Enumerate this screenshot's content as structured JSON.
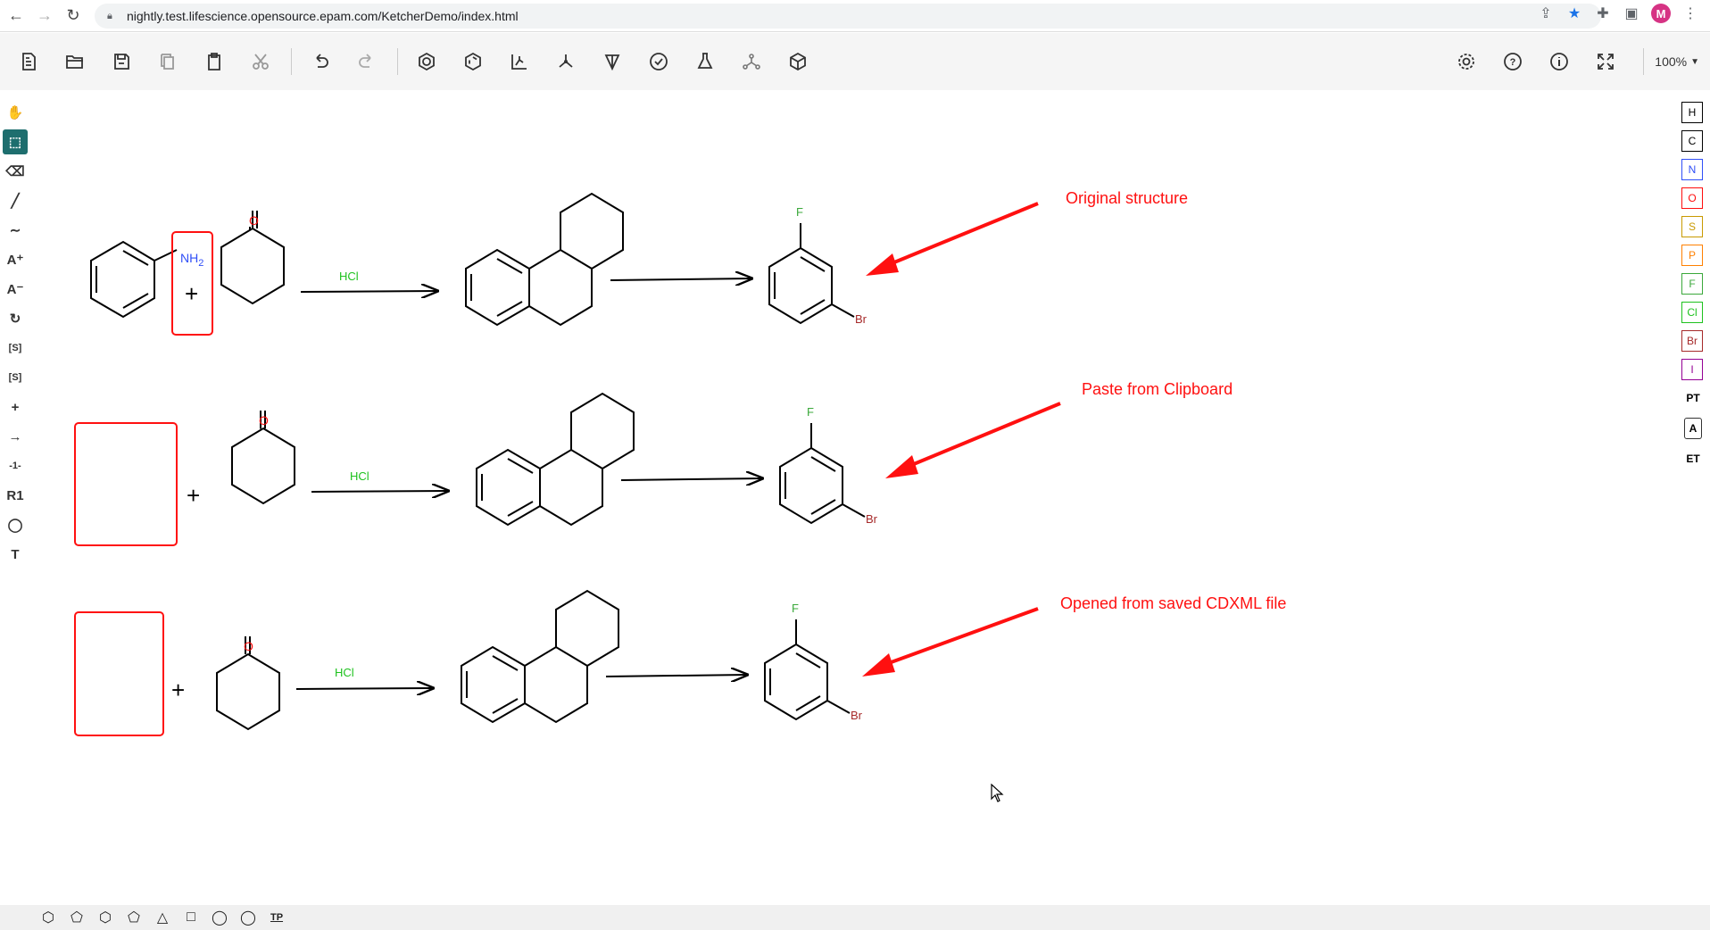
{
  "browser": {
    "url": "nightly.test.lifescience.opensource.epam.com/KetcherDemo/index.html",
    "profile_initial": "M"
  },
  "toolbar": {
    "zoom": "100%"
  },
  "left_tools": [
    {
      "name": "hand-tool",
      "glyph": "✋"
    },
    {
      "name": "select-tool",
      "glyph": "⬚"
    },
    {
      "name": "erase-tool",
      "glyph": "⌫"
    },
    {
      "name": "bond-tool",
      "glyph": "╱"
    },
    {
      "name": "chain-tool",
      "glyph": "∼"
    },
    {
      "name": "charge-plus-tool",
      "glyph": "A⁺"
    },
    {
      "name": "charge-minus-tool",
      "glyph": "A⁻"
    },
    {
      "name": "rotate-tool",
      "glyph": "↻"
    },
    {
      "name": "sgroup-tool",
      "glyph": "[S]"
    },
    {
      "name": "sgroup-data-tool",
      "glyph": "[S]"
    },
    {
      "name": "reaction-plus-tool",
      "glyph": "+"
    },
    {
      "name": "reaction-arrow-tool",
      "glyph": "→"
    },
    {
      "name": "reaction-mapping-tool",
      "glyph": "-1-"
    },
    {
      "name": "rgroup-tool",
      "glyph": "R1"
    },
    {
      "name": "shape-tool",
      "glyph": "◯"
    },
    {
      "name": "text-tool",
      "glyph": "T"
    }
  ],
  "atoms": [
    {
      "symbol": "H",
      "color": "#000000"
    },
    {
      "symbol": "C",
      "color": "#000000"
    },
    {
      "symbol": "N",
      "color": "#304ff7"
    },
    {
      "symbol": "O",
      "color": "#ff0d0d"
    },
    {
      "symbol": "S",
      "color": "#c99a00"
    },
    {
      "symbol": "P",
      "color": "#ff8000"
    },
    {
      "symbol": "F",
      "color": "#3ba83b"
    },
    {
      "symbol": "Cl",
      "color": "#1ec21e"
    },
    {
      "symbol": "Br",
      "color": "#a62929"
    },
    {
      "symbol": "I",
      "color": "#940094"
    }
  ],
  "right_extras": [
    "PT",
    "A",
    "ET"
  ],
  "bottom_shapes": [
    "⬡",
    "⬠",
    "⬡",
    "⬠",
    "△",
    "□",
    "◯",
    "◯",
    "TP"
  ],
  "canvas": {
    "row1": {
      "nh2": "NH",
      "nh2_sub": "2",
      "oxygen": "O",
      "catalyst": "HCl",
      "fluorine": "F",
      "bromine": "Br"
    },
    "row2": {
      "oxygen": "O",
      "catalyst": "HCl",
      "fluorine": "F",
      "bromine": "Br"
    },
    "row3": {
      "oxygen": "O",
      "catalyst": "HCl",
      "fluorine": "F",
      "bromine": "Br"
    },
    "annotations": [
      "Original structure",
      "Paste from Clipboard",
      "Opened from saved CDXML file"
    ]
  }
}
